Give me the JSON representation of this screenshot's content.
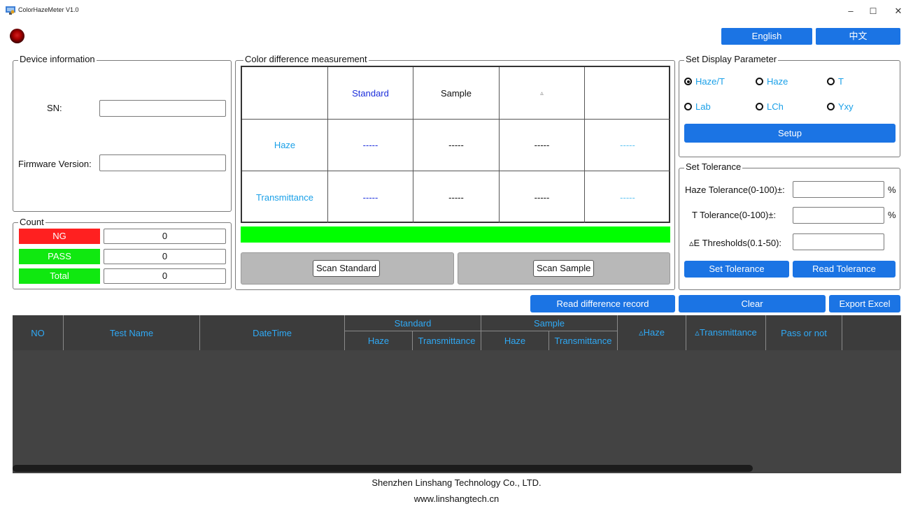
{
  "window": {
    "title": "ColorHazeMeter V1.0",
    "controls": [
      "–",
      "☐",
      "✕"
    ]
  },
  "language": {
    "english": "English",
    "chinese": "中文"
  },
  "device_info": {
    "title": "Device information",
    "sn_label": "SN:",
    "sn_value": "",
    "firmware_label": "Firmware Version:",
    "firmware_value": ""
  },
  "count": {
    "title": "Count",
    "rows": [
      {
        "label": "NG",
        "value": "0",
        "color": "#ff2020"
      },
      {
        "label": "PASS",
        "value": "0",
        "color": "#10e810"
      },
      {
        "label": "Total",
        "value": "0",
        "color": "#10e810"
      }
    ]
  },
  "measurement": {
    "title": "Color difference measurement",
    "headers": [
      "",
      "Standard",
      "Sample",
      "▵",
      ""
    ],
    "rows": [
      {
        "label": "Haze",
        "cells": [
          "-----",
          "-----",
          "-----",
          "-----"
        ]
      },
      {
        "label": "Transmittance",
        "cells": [
          "-----",
          "-----",
          "-----",
          "-----"
        ]
      }
    ],
    "result_bar_color": "#00ff00",
    "scan_standard": "Scan Standard",
    "scan_sample": "Scan Sample"
  },
  "display_param": {
    "title": "Set Display Parameter",
    "options": [
      {
        "label": "Haze/T",
        "checked": true
      },
      {
        "label": "Haze",
        "checked": false
      },
      {
        "label": "T",
        "checked": false
      },
      {
        "label": "Lab",
        "checked": false
      },
      {
        "label": "LCh",
        "checked": false
      },
      {
        "label": "Yxy",
        "checked": false
      }
    ],
    "setup": "Setup"
  },
  "tolerance": {
    "title": "Set Tolerance",
    "haze_label": "Haze Tolerance(0-100)±:",
    "haze_value": "",
    "haze_unit": "%",
    "t_label": "T Tolerance(0-100)±:",
    "t_value": "",
    "t_unit": "%",
    "e_label": "▵E Thresholds(0.1-50):",
    "e_value": "",
    "set_button": "Set Tolerance",
    "read_button": "Read Tolerance"
  },
  "actions": {
    "read_record": "Read difference record",
    "clear": "Clear",
    "export": "Export Excel"
  },
  "grid": {
    "columns": {
      "no": "NO",
      "test_name": "Test Name",
      "datetime": "DateTime",
      "standard": "Standard",
      "sample": "Sample",
      "haze": "Haze",
      "transmittance": "Transmittance",
      "d_haze": "▵Haze",
      "d_transmittance": "▵Transmittance",
      "pass": "Pass or not"
    },
    "rows": []
  },
  "footer": {
    "company": "Shenzhen Linshang Technology Co., LTD.",
    "website": "www.linshangtech.cn"
  },
  "colors": {
    "accent_blue": "#1b74e4",
    "grid_text": "#2fa9f5",
    "grid_bg": "#434343"
  }
}
